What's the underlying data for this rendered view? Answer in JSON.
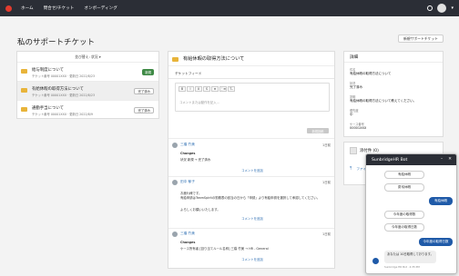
{
  "nav": {
    "home": "ホーム",
    "ask": "問合せ/チケット",
    "onboarding": "オンボーディング"
  },
  "page": {
    "title": "私のサポートチケット",
    "new_button": "新規サポートチケット"
  },
  "list": {
    "filter_label": "並び替え: 状況 ▾",
    "tickets": [
      {
        "title": "給与制度について",
        "meta": "チケット番号 00001XXX · 更新日 2022/8/23",
        "badge": "新規"
      },
      {
        "title": "有給休暇の取得方法について",
        "meta": "チケット番号 00001XXX · 更新日 2022/8/23",
        "badge": "完了済み"
      },
      {
        "title": "通勤手当について",
        "meta": "チケット番号 00001XXX · 更新日 2022/8/9",
        "badge": "完了済み"
      }
    ]
  },
  "ticket": {
    "title": "有給休暇の取得方法について",
    "feed_tab": "チケットフィード",
    "toolbar": [
      "B",
      "I",
      "U",
      "S",
      "≡",
      "⋮≡",
      "Tₓ"
    ],
    "placeholder": "コメントまたは動作を記入...",
    "post_button": "新規投稿",
    "comments": [
      {
        "author": "三橋 竹美",
        "date": "1日前",
        "line1": "Changes",
        "line2": "状況 新規 → 完了済み"
      },
      {
        "author": "田中 郁子",
        "date": "1日前",
        "line1": "お疲れ様です。",
        "line2": "有給申請はTeamSpiritの勤務表の該当の日から「申請」より有給申請を選択して承認してください。",
        "line3": "よろしくお願いいたします。"
      },
      {
        "author": "三橋 竹美",
        "date": "1日前",
        "line1": "Changes",
        "line2": "ケース所有者 [割り当てルール名称] 三橋 竹美 → HR - General"
      }
    ],
    "add_comment": "コメントを追加"
  },
  "details": {
    "title": "詳細",
    "fields": [
      {
        "label": "件名",
        "value": "有給休暇の取得方法について"
      },
      {
        "label": "状況",
        "value": "完了済み"
      },
      {
        "label": "説明",
        "value": "有給休暇の取得方法について教えてください。"
      },
      {
        "label": "優先度",
        "value": "中"
      },
      {
        "label": "ケース番号",
        "value": "00001XXX"
      }
    ]
  },
  "files": {
    "title": "添付件 (0)",
    "upload": "ファイルをアップロード"
  },
  "bot": {
    "title": "SunbridgeHR Bot",
    "minimize": "–",
    "close": "✕",
    "options_1": [
      "有給休暇",
      "慶弔休暇"
    ],
    "user_1": "有給休暇",
    "options_2": [
      "今年度の取得数",
      "今年度の取得日数"
    ],
    "user_2": "今年度の取得日数",
    "bot_message": "あなたは 10日取得しております。",
    "timestamp": "Sunbridge HR Bot · 4:35 PM"
  }
}
